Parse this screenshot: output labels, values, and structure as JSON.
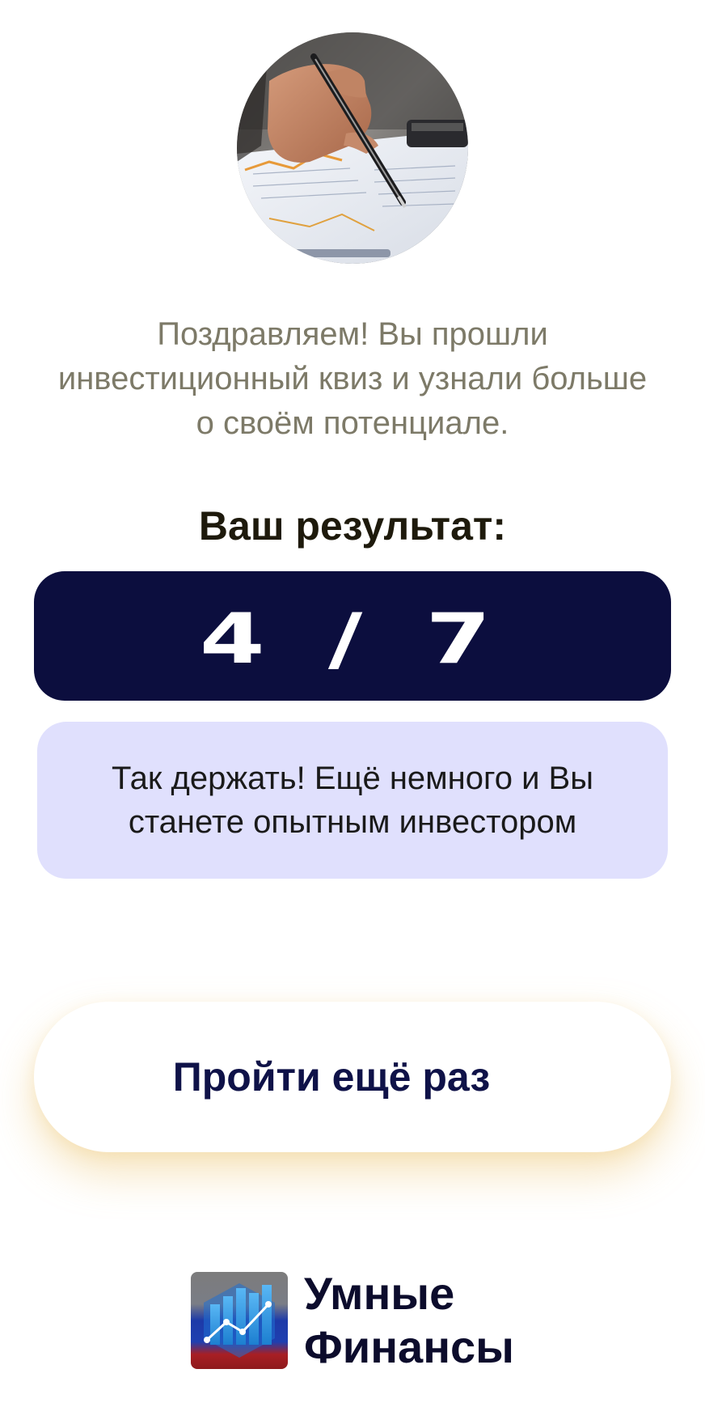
{
  "hero": {
    "image": "hand-with-pen-over-financial-documents"
  },
  "congrats": {
    "line1": "Поздравляем! Вы прошли",
    "line2": "инвестиционный квиз и узнали больше",
    "line3": "о своём потенциале."
  },
  "result": {
    "label": "Ваш результат:",
    "score": "4 / 7",
    "correct": 4,
    "total": 7
  },
  "feedback": {
    "line1": "Так держать! Ещё немного и Вы",
    "line2": "станете опытным инвестором"
  },
  "retry_button": {
    "label": "Пройти ещё раз"
  },
  "brand": {
    "logo_icon": "chart-growth-logo-icon",
    "name_line1": "Умные",
    "name_line2": "Финансы"
  },
  "colors": {
    "score_bg": "#0c0e3e",
    "feedback_bg": "#e0e0fd",
    "button_text": "#0f1248",
    "button_glow": "#ebbe5f",
    "congrats_text": "#7d7a68"
  }
}
